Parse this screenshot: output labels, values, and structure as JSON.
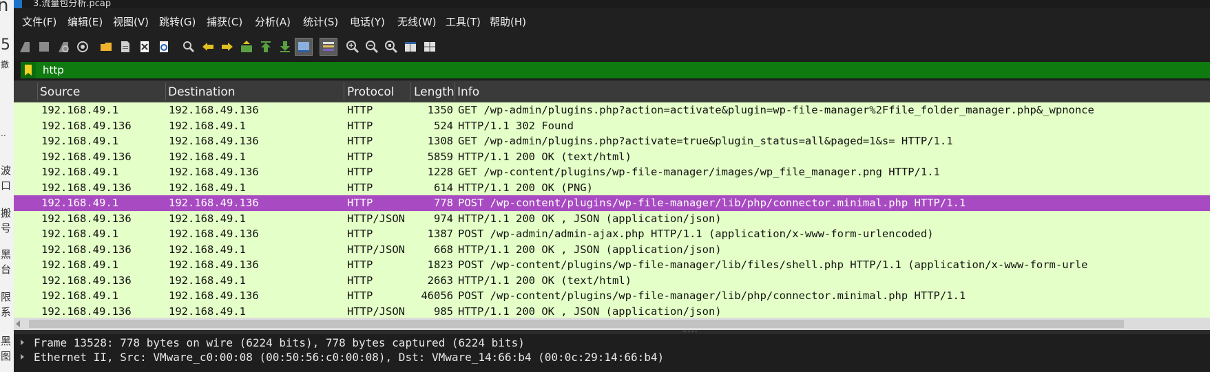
{
  "window": {
    "title": "3.流量包分析.pcap"
  },
  "menu": [
    "文件(F)",
    "编辑(E)",
    "视图(V)",
    "跳转(G)",
    "捕获(C)",
    "分析(A)",
    "统计(S)",
    "电话(Y)",
    "无线(W)",
    "工具(T)",
    "帮助(H)"
  ],
  "toolbar_icons": [
    "start-capture-icon",
    "stop-capture-icon",
    "restart-capture-icon",
    "capture-options-icon",
    "open-file-icon",
    "save-file-icon",
    "close-file-icon",
    "reload-file-icon",
    "find-packet-icon",
    "go-back-icon",
    "go-forward-icon",
    "go-to-packet-icon",
    "first-packet-icon",
    "last-packet-icon",
    "autoscroll-icon",
    "colorize-icon",
    "zoom-in-icon",
    "zoom-out-icon",
    "zoom-normal-icon",
    "resize-columns-icon",
    "layout-icon"
  ],
  "filter": {
    "value": "http"
  },
  "columns": {
    "source": "Source",
    "destination": "Destination",
    "protocol": "Protocol",
    "length": "Length",
    "info": "Info"
  },
  "packets": [
    {
      "src": "192.168.49.1",
      "dst": "192.168.49.136",
      "proto": "HTTP",
      "len": "1350",
      "info": "GET /wp-admin/plugins.php?action=activate&plugin=wp-file-manager%2Ffile_folder_manager.php&_wpnonce",
      "selected": false
    },
    {
      "src": "192.168.49.136",
      "dst": "192.168.49.1",
      "proto": "HTTP",
      "len": "524",
      "info": "HTTP/1.1 302 Found",
      "selected": false
    },
    {
      "src": "192.168.49.1",
      "dst": "192.168.49.136",
      "proto": "HTTP",
      "len": "1308",
      "info": "GET /wp-admin/plugins.php?activate=true&plugin_status=all&paged=1&s= HTTP/1.1",
      "selected": false
    },
    {
      "src": "192.168.49.136",
      "dst": "192.168.49.1",
      "proto": "HTTP",
      "len": "5859",
      "info": "HTTP/1.1 200 OK  (text/html)",
      "selected": false
    },
    {
      "src": "192.168.49.1",
      "dst": "192.168.49.136",
      "proto": "HTTP",
      "len": "1228",
      "info": "GET /wp-content/plugins/wp-file-manager/images/wp_file_manager.png HTTP/1.1",
      "selected": false
    },
    {
      "src": "192.168.49.136",
      "dst": "192.168.49.1",
      "proto": "HTTP",
      "len": "614",
      "info": "HTTP/1.1 200 OK  (PNG)",
      "selected": false
    },
    {
      "src": "192.168.49.1",
      "dst": "192.168.49.136",
      "proto": "HTTP",
      "len": "778",
      "info": "POST /wp-content/plugins/wp-file-manager/lib/php/connector.minimal.php HTTP/1.1",
      "selected": true
    },
    {
      "src": "192.168.49.136",
      "dst": "192.168.49.1",
      "proto": "HTTP/JSON",
      "len": "974",
      "info": "HTTP/1.1 200 OK , JSON (application/json)",
      "selected": false
    },
    {
      "src": "192.168.49.1",
      "dst": "192.168.49.136",
      "proto": "HTTP",
      "len": "1387",
      "info": "POST /wp-admin/admin-ajax.php HTTP/1.1  (application/x-www-form-urlencoded)",
      "selected": false
    },
    {
      "src": "192.168.49.136",
      "dst": "192.168.49.1",
      "proto": "HTTP/JSON",
      "len": "668",
      "info": "HTTP/1.1 200 OK , JSON (application/json)",
      "selected": false
    },
    {
      "src": "192.168.49.1",
      "dst": "192.168.49.136",
      "proto": "HTTP",
      "len": "1823",
      "info": "POST /wp-content/plugins/wp-file-manager/lib/files/shell.php HTTP/1.1  (application/x-www-form-urle",
      "selected": false
    },
    {
      "src": "192.168.49.136",
      "dst": "192.168.49.1",
      "proto": "HTTP",
      "len": "2663",
      "info": "HTTP/1.1 200 OK  (text/html)",
      "selected": false
    },
    {
      "src": "192.168.49.1",
      "dst": "192.168.49.136",
      "proto": "HTTP",
      "len": "46056",
      "info": "POST /wp-content/plugins/wp-file-manager/lib/php/connector.minimal.php HTTP/1.1",
      "selected": false
    },
    {
      "src": "192.168.49.136",
      "dst": "192.168.49.1",
      "proto": "HTTP/JSON",
      "len": "985",
      "info": "HTTP/1.1 200 OK , JSON (application/json)",
      "selected": false
    }
  ],
  "details": [
    "Frame 13528: 778 bytes on wire (6224 bits), 778 bytes captured (6224 bits)",
    "Ethernet II, Src: VMware_c0:00:08 (00:50:56:c0:00:08), Dst: VMware_14:66:b4 (00:0c:29:14:66:b4)"
  ],
  "background_window": {
    "fragments": [
      "n",
      "5",
      "撤",
      "..",
      "波",
      "口",
      "搬",
      "号",
      "黑",
      "台",
      "限",
      "系",
      "黑",
      "图"
    ]
  },
  "colors": {
    "row_bg": "#e4ffc7",
    "selected_bg": "#a84bc2",
    "filter_bg": "#0f7a0f"
  }
}
